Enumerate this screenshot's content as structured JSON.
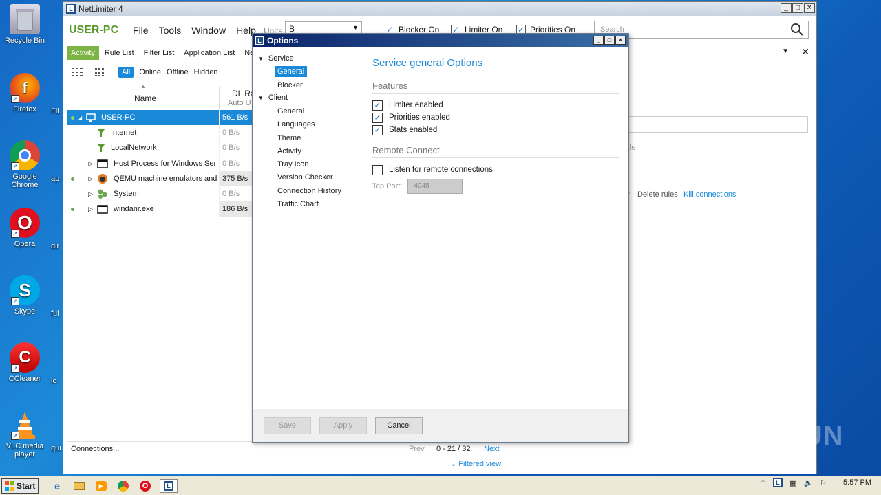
{
  "desktop": {
    "icons": [
      {
        "label": "Recycle Bin"
      },
      {
        "label": "Firefox",
        "side": "Fil"
      },
      {
        "label": "Google Chrome",
        "side": "ap"
      },
      {
        "label": "Opera",
        "side": "dir"
      },
      {
        "label": "Skype",
        "side": "ful"
      },
      {
        "label": "CCleaner",
        "side": "lo"
      },
      {
        "label": "VLC media player",
        "side": "qui"
      }
    ]
  },
  "main_window": {
    "title": "NetLimiter 4",
    "host": "USER-PC",
    "menu": [
      "File",
      "Tools",
      "Window",
      "Help"
    ],
    "units_label": "Units",
    "units_value": "B",
    "toggles": [
      "Blocker On",
      "Limiter On",
      "Priorities On"
    ],
    "search_placeholder": "Search",
    "tabs": [
      "Activity",
      "Rule List",
      "Filter List",
      "Application List",
      "Ne"
    ],
    "filters": [
      "All",
      "Online",
      "Offline",
      "Hidden"
    ],
    "columns": {
      "name": "Name",
      "dl_rate": "DL Ra",
      "dl_sub": "Auto U"
    },
    "rows": [
      {
        "name": "USER-PC",
        "rate": "561 B/s"
      },
      {
        "name": "Internet",
        "rate": "0 B/s"
      },
      {
        "name": "LocalNetwork",
        "rate": "0 B/s"
      },
      {
        "name": "Host Process for Windows Ser",
        "rate": "0 B/s"
      },
      {
        "name": "QEMU machine emulators and",
        "rate": "375 B/s"
      },
      {
        "name": "System",
        "rate": "0 B/s"
      },
      {
        "name": "windanr.exe",
        "rate": "186 B/s"
      }
    ],
    "right_panel": {
      "text_fragment": "le",
      "delete_rules": "Delete rules",
      "kill_connections": "Kill connections"
    },
    "status": {
      "connections": "Connections...",
      "prev": "Prev",
      "range": "0 - 21 / 32",
      "next": "Next",
      "filtered_view": "Filtered view"
    }
  },
  "options_dialog": {
    "title": "Options",
    "nav": {
      "service": {
        "label": "Service",
        "children": [
          "General",
          "Blocker"
        ]
      },
      "client": {
        "label": "Client",
        "children": [
          "General",
          "Languages",
          "Theme",
          "Activity",
          "Tray Icon",
          "Version Checker",
          "Connection History",
          "Traffic Chart"
        ]
      }
    },
    "heading": "Service general Options",
    "features_title": "Features",
    "features": [
      {
        "label": "Limiter enabled",
        "checked": true
      },
      {
        "label": "Priorities enabled",
        "checked": true
      },
      {
        "label": "Stats enabled",
        "checked": true
      }
    ],
    "remote_title": "Remote Connect",
    "remote_listen": {
      "label": "Listen for remote connections",
      "checked": false
    },
    "tcp_port_label": "Tcp Port:",
    "tcp_port_value": "4045",
    "buttons": {
      "save": "Save",
      "apply": "Apply",
      "cancel": "Cancel"
    }
  },
  "taskbar": {
    "start": "Start",
    "clock": "5:57 PM"
  },
  "watermark": "ANY RUN",
  "colors": {
    "accent_blue": "#1a8ad8",
    "accent_green": "#7cb545",
    "title_dark": "#0a246a"
  }
}
